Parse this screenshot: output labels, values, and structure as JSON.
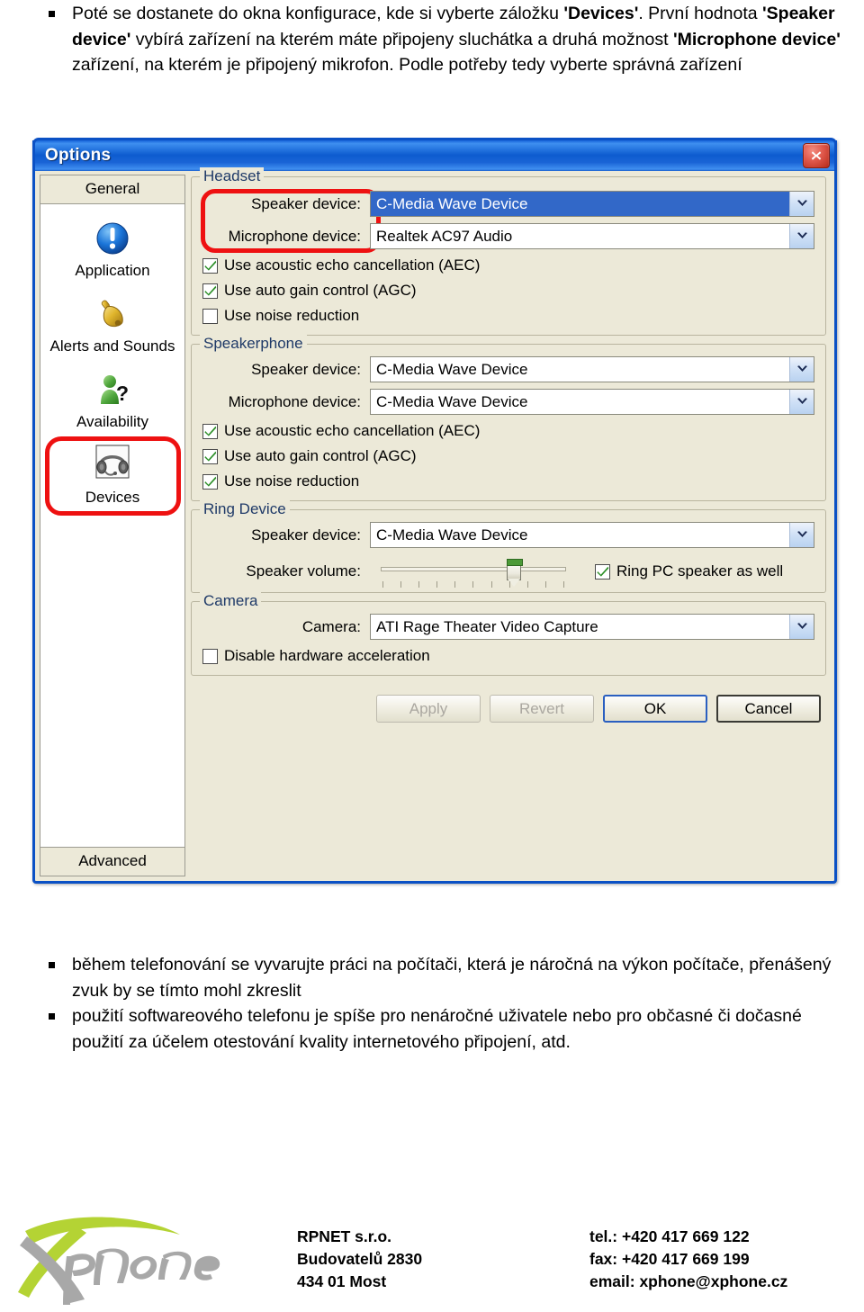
{
  "document": {
    "top_paragraphs": [
      "Poté se dostanete do okna konfigurace, kde si vyberte záložku 'Devices'. První hodnota 'Speaker device' vybírá zařízení na kterém máte připojeny sluchátka a druhá možnost 'Microphone device' zařízení, na kterém je připojený mikrofon. Podle potřeby tedy vyberte správná zařízení"
    ],
    "bottom_paragraphs": [
      "během telefonování se vyvarujte práci na počítači, která je náročná na výkon počítače, přenášený zvuk by se tímto mohl zkreslit",
      "použití softwareového telefonu je spíše pro nenáročné uživatele nebo pro občasné či dočasné použití za účelem otestování kvality internetového připojení, atd."
    ]
  },
  "dialog": {
    "title": "Options",
    "close_tooltip": "Close",
    "sidebar": {
      "top_tab": "General",
      "bottom_tab": "Advanced",
      "items": [
        {
          "label": "Application",
          "icon": "info-circle-icon",
          "selected": false
        },
        {
          "label": "Alerts and Sounds",
          "icon": "bell-icon",
          "selected": false
        },
        {
          "label": "Availability",
          "icon": "person-question-icon",
          "selected": false
        },
        {
          "label": "Devices",
          "icon": "headset-icon",
          "selected": true
        }
      ]
    },
    "groups": [
      {
        "legend": "Headset",
        "fields": [
          {
            "label": "Speaker device:",
            "value": "C-Media Wave Device",
            "highlighted": true
          },
          {
            "label": "Microphone device:",
            "value": "Realtek AC97 Audio",
            "highlighted": false
          }
        ],
        "checks": [
          {
            "label": "Use acoustic echo cancellation (AEC)",
            "checked": true
          },
          {
            "label": "Use auto gain control (AGC)",
            "checked": true
          },
          {
            "label": "Use noise reduction",
            "checked": false
          }
        ]
      },
      {
        "legend": "Speakerphone",
        "fields": [
          {
            "label": "Speaker device:",
            "value": "C-Media Wave Device",
            "highlighted": false
          },
          {
            "label": "Microphone device:",
            "value": "C-Media Wave Device",
            "highlighted": false
          }
        ],
        "checks": [
          {
            "label": "Use acoustic echo cancellation (AEC)",
            "checked": true
          },
          {
            "label": "Use auto gain control (AGC)",
            "checked": true
          },
          {
            "label": "Use noise reduction",
            "checked": true
          }
        ]
      },
      {
        "legend": "Ring Device",
        "fields": [
          {
            "label": "Speaker device:",
            "value": "C-Media Wave Device",
            "highlighted": false
          }
        ],
        "slider": {
          "label": "Speaker volume:",
          "value_percent": 70,
          "tick_count": 11
        },
        "side_check": {
          "label": "Ring PC speaker as well",
          "checked": true
        }
      },
      {
        "legend": "Camera",
        "fields": [
          {
            "label": "Camera:",
            "value": "ATI Rage Theater Video Capture",
            "highlighted": false
          }
        ],
        "checks": [
          {
            "label": "Disable hardware acceleration",
            "checked": false
          }
        ]
      }
    ],
    "buttons": [
      {
        "label": "Apply",
        "state": "disabled"
      },
      {
        "label": "Revert",
        "state": "disabled"
      },
      {
        "label": "OK",
        "state": "default"
      },
      {
        "label": "Cancel",
        "state": "normal"
      }
    ]
  },
  "footer": {
    "logo_text": "Xphone",
    "company": {
      "name": "RPNET s.r.o.",
      "street": "Budovatelů 2830",
      "city": "434 01 Most"
    },
    "contact": {
      "tel": "tel.: +420 417 669 122",
      "fax": "fax: +420 417 669 199",
      "email": "email: xphone@xphone.cz"
    }
  },
  "colors": {
    "titlebar_blue": "#0d5ccf",
    "dialog_face": "#ece9d8",
    "highlight_blue": "#3268c8",
    "annotation_red": "#ee1111",
    "logo_green": "#b4d334",
    "logo_gray": "#a8a8a8"
  }
}
